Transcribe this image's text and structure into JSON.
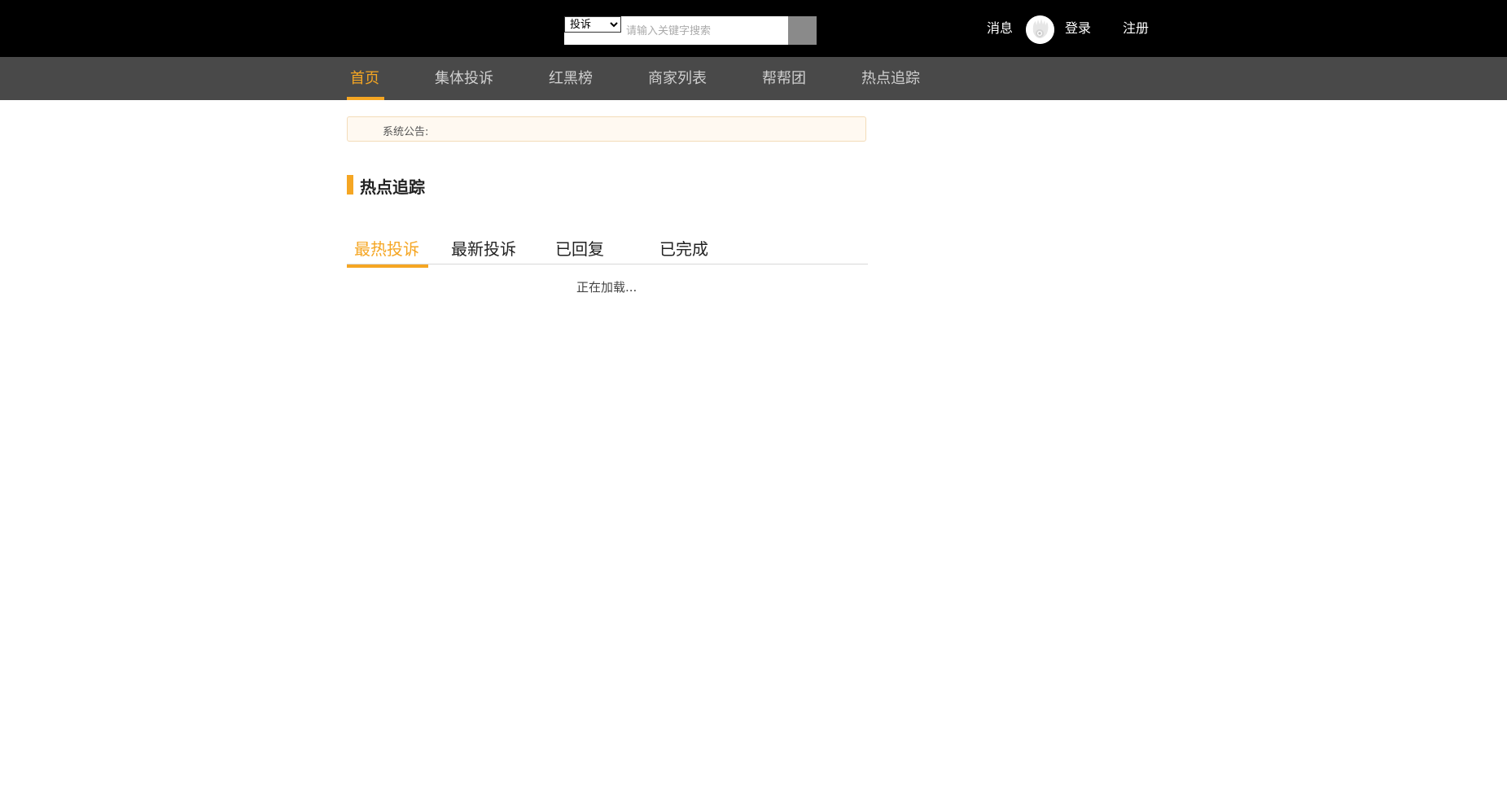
{
  "search": {
    "category_selected": "投诉",
    "category_options": [
      "投诉"
    ],
    "placeholder": "请输入关键字搜索",
    "value": ""
  },
  "user_bar": {
    "messages": "消息",
    "login": "登录",
    "register": "注册"
  },
  "nav": {
    "items": [
      {
        "label": "首页",
        "active": true
      },
      {
        "label": "集体投诉"
      },
      {
        "label": "红黑榜"
      },
      {
        "label": "商家列表"
      },
      {
        "label": "帮帮团"
      },
      {
        "label": "热点追踪"
      }
    ]
  },
  "notice": {
    "label": "系统公告:"
  },
  "section": {
    "title": "热点追踪"
  },
  "tabs": [
    {
      "label": "最热投诉",
      "active": true
    },
    {
      "label": "最新投诉"
    },
    {
      "label": "已回复"
    },
    {
      "label": "已完成"
    }
  ],
  "loading_text": "正在加载...",
  "colors": {
    "accent": "#f5a623",
    "topbar": "#000000",
    "navbar": "#494949",
    "search_button": "#8a8a8a"
  },
  "icons": {
    "avatar": "user-avatar-icon",
    "search_button": "search-icon"
  }
}
